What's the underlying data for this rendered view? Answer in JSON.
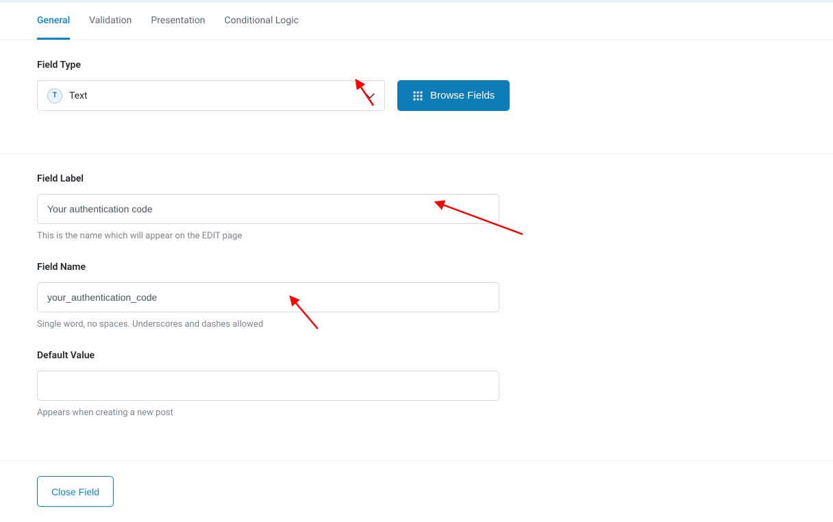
{
  "tabs": [
    {
      "label": "General",
      "active": true
    },
    {
      "label": "Validation",
      "active": false
    },
    {
      "label": "Presentation",
      "active": false
    },
    {
      "label": "Conditional Logic",
      "active": false
    }
  ],
  "fieldType": {
    "label": "Field Type",
    "iconLetter": "T",
    "value": "Text",
    "browse": "Browse Fields"
  },
  "fieldLabel": {
    "label": "Field Label",
    "value": "Your authentication code",
    "help": "This is the name which will appear on the EDIT page"
  },
  "fieldName": {
    "label": "Field Name",
    "value": "your_authentication_code",
    "help": "Single word, no spaces. Underscores and dashes allowed"
  },
  "defaultValue": {
    "label": "Default Value",
    "value": "",
    "help": "Appears when creating a new post"
  },
  "footer": {
    "close": "Close Field"
  }
}
